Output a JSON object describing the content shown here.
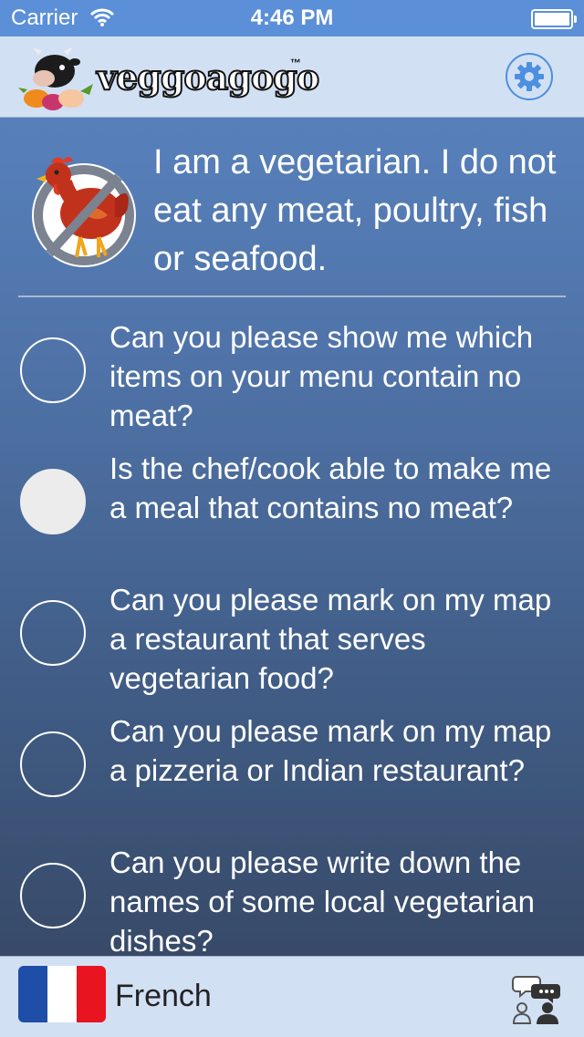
{
  "status_bar": {
    "carrier": "Carrier",
    "time": "4:46 PM"
  },
  "header": {
    "logo_text": "veggoagogo",
    "logo_tm": "™",
    "settings_icon": "gear-icon"
  },
  "statement": {
    "icon": "no-chicken-icon",
    "text": "I am a vegetarian. I do not eat any meat, poultry, fish or seafood."
  },
  "questions": [
    {
      "text": "Can you please show me which items on your menu contain no meat?",
      "selected": false
    },
    {
      "text": "Is the chef/cook able to make me a meal that contains no meat?",
      "selected": true
    },
    {
      "text": "Can you please mark on my map a restaurant that serves vegetarian food?",
      "selected": false
    },
    {
      "text": "Can you please mark on my map a pizzeria or Indian restaurant?",
      "selected": false
    },
    {
      "text": "Can you please write down the names of some local vegetarian dishes?",
      "selected": false
    }
  ],
  "footer": {
    "language": "French",
    "flag_colors": [
      "#1f4ea8",
      "#ffffff",
      "#e8141f"
    ],
    "chat_icon": "conversation-icon"
  },
  "colors": {
    "accent": "#4d8fe0",
    "status_bar": "#5b8fd8",
    "header_bg": "#d2e0f4"
  }
}
